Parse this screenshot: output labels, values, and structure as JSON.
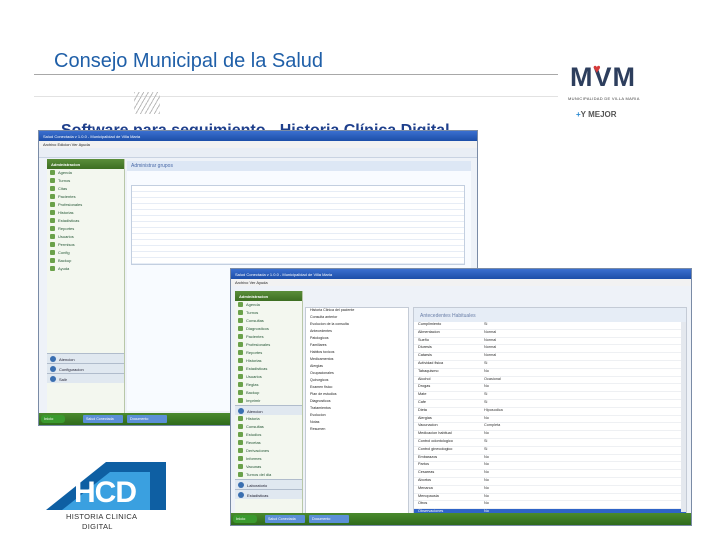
{
  "slide": {
    "title": "Consejo Municipal de la Salud",
    "subtitle": "Software para seguimiento -  Historia Clínica Digital"
  },
  "mvm_logo": {
    "letters": "MVM",
    "sub": "MUNICIPALIDAD DE VILLA MARIA",
    "slogan_plus": "+",
    "slogan": "Y MEJOR",
    "colors": {
      "text": "#2d3e5d",
      "heart": "#d63a3a",
      "plus": "#2b8ad1"
    }
  },
  "hcd_logo": {
    "letters": "HCD",
    "caption_line1": "HISTORIA CLINICA",
    "caption_line2": "DIGITAL",
    "colors": {
      "dark": "#0e5fa3",
      "light": "#3aa0e0"
    }
  },
  "window_back": {
    "title": "Salud Conectada v 1.0.0 - Municipalidad de Villa Maria",
    "menu": "Archivo  Edicion  Ver  Ayuda",
    "nav_header": "Administracion",
    "nav_items": [
      "Agenda",
      "Turnos",
      "Citas",
      "Pacientes",
      "Profesionales",
      "Historias",
      "Estadisticas",
      "Reportes",
      "Usuarios",
      "Permisos",
      "Config",
      "Backup",
      "Ayuda"
    ],
    "nav_groups": [
      "Atencion",
      "Configuracion",
      "Salir"
    ],
    "form_heading": "Administrar grupos",
    "taskbar": {
      "start": "Inicio",
      "tasks": [
        "Salud Conectada",
        "Documento"
      ]
    }
  },
  "window_front": {
    "title": "Salud Conectada v 1.0.0 - Municipalidad de Villa Maria",
    "menu": "Archivo  Ver  Ayuda",
    "nav_header": "Administracion",
    "nav_items": [
      "Agenda",
      "Turnos",
      "Consultas",
      "Diagnosticos",
      "Pacientes",
      "Profesionales",
      "Reportes",
      "Historias",
      "Estadisticas",
      "Usuarios",
      "Reglas",
      "Backup",
      "Imprimir"
    ],
    "nav_group_mid": "Atencion",
    "nav_items2": [
      "Historia",
      "Consultas",
      "Estudios",
      "Recetas",
      "Derivaciones",
      "Informes",
      "Vacunas",
      "Turnos del dia"
    ],
    "nav_groups_bottom": [
      "Laboratorio",
      "Estadisticas"
    ],
    "tree_rows": [
      "Historia Clinica del paciente",
      "  Consulta anterior",
      "  Evolucion de la consulta",
      "  Antecedentes",
      "    Patologicos",
      "    Familiares",
      "    Habitos toxicos",
      "    Medicamentos",
      "    Alergias",
      "    Ocupacionales",
      "    Quirurgicos",
      "  Examen fisico",
      "  Plan de estudios",
      "  Diagnosticos",
      "  Tratamientos",
      "  Evolucion",
      "  Notas",
      "  Resumen"
    ],
    "detail_heading": "Antecedentes Habituales",
    "detail_rows": [
      {
        "label": "Cumplimiento",
        "value": "Si"
      },
      {
        "label": "Alimentacion",
        "value": "Normal"
      },
      {
        "label": "Sueño",
        "value": "Normal"
      },
      {
        "label": "Diuresis",
        "value": "Normal"
      },
      {
        "label": "Catarsis",
        "value": "Normal"
      },
      {
        "label": "Actividad fisica",
        "value": "Si"
      },
      {
        "label": "Tabaquismo",
        "value": "No"
      },
      {
        "label": "Alcohol",
        "value": "Ocasional"
      },
      {
        "label": "Drogas",
        "value": "No"
      },
      {
        "label": "Mate",
        "value": "Si"
      },
      {
        "label": "Cafe",
        "value": "Si"
      },
      {
        "label": "Dieta",
        "value": "Hiposodica"
      },
      {
        "label": "Alergias",
        "value": "No"
      },
      {
        "label": "Vacunacion",
        "value": "Completa"
      },
      {
        "label": "Medicacion habitual",
        "value": "No"
      },
      {
        "label": "Control odontologico",
        "value": "Si"
      },
      {
        "label": "Control ginecologico",
        "value": "Si"
      },
      {
        "label": "Embarazos",
        "value": "No"
      },
      {
        "label": "Partos",
        "value": "No"
      },
      {
        "label": "Cesareas",
        "value": "No"
      },
      {
        "label": "Abortos",
        "value": "No"
      },
      {
        "label": "Menarca",
        "value": "No"
      },
      {
        "label": "Menopausia",
        "value": "No"
      },
      {
        "label": "Otros",
        "value": "No"
      },
      {
        "label": "Observaciones",
        "value": "No"
      },
      {
        "label": "Estado",
        "value": "No"
      }
    ],
    "selected_row": 24,
    "taskbar": {
      "start": "Inicio",
      "tasks": [
        "Salud Conectada",
        "Documento"
      ]
    }
  }
}
